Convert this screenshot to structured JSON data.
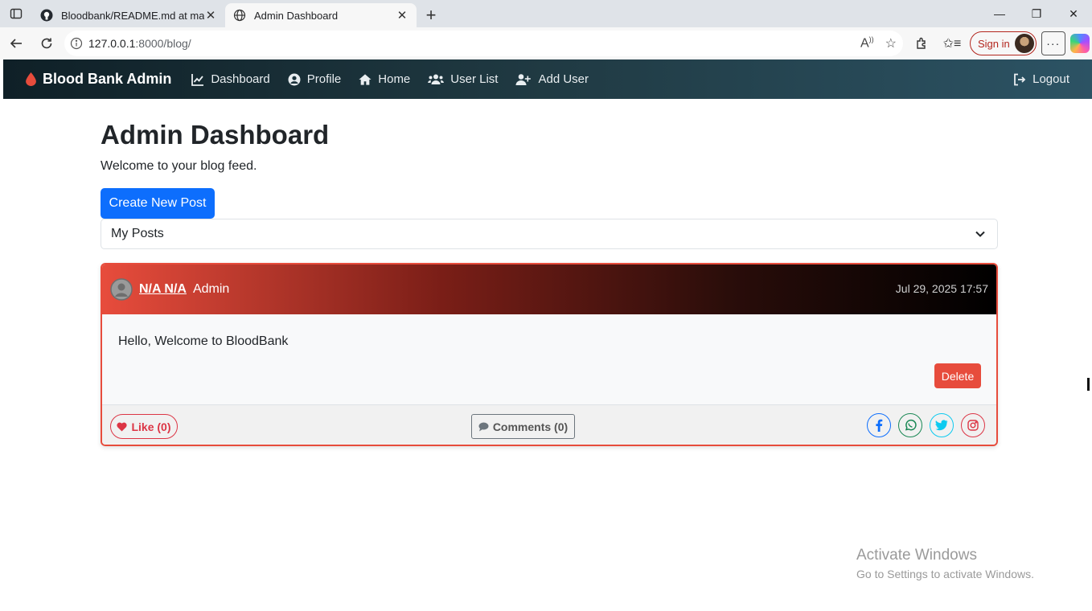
{
  "browser": {
    "tabs": [
      {
        "title": "Bloodbank/README.md at main ·",
        "favicon": "github-icon",
        "active": false
      },
      {
        "title": "Admin Dashboard",
        "favicon": "globe-icon",
        "active": true
      }
    ],
    "url_host": "127.0.0.1",
    "url_path": ":8000/blog/",
    "signin_label": "Sign in"
  },
  "nav": {
    "brand": "Blood Bank Admin",
    "links": [
      {
        "label": "Dashboard",
        "icon": "chart-line-icon"
      },
      {
        "label": "Profile",
        "icon": "user-circle-icon"
      },
      {
        "label": "Home",
        "icon": "home-icon"
      },
      {
        "label": "User List",
        "icon": "users-icon"
      },
      {
        "label": "Add User",
        "icon": "user-plus-icon"
      }
    ],
    "logout": "Logout"
  },
  "page": {
    "title": "Admin Dashboard",
    "lead": "Welcome to your blog feed.",
    "create_button": "Create New Post",
    "filter_selected": "My Posts"
  },
  "post": {
    "author": "N/A N/A",
    "role": "Admin",
    "date": "Jul 29, 2025 17:57",
    "body": "Hello, Welcome to BloodBank",
    "delete_label": "Delete",
    "like_label": "Like (0)",
    "comments_label": "Comments (0)",
    "share_icons": [
      "facebook-icon",
      "whatsapp-icon",
      "twitter-icon",
      "instagram-icon"
    ]
  },
  "watermark": {
    "line1": "Activate Windows",
    "line2": "Go to Settings to activate Windows."
  },
  "colors": {
    "primary": "#0d6efd",
    "danger": "#e74c3c",
    "nav_gradient_start": "#0f2027",
    "nav_gradient_end": "#2c5364"
  }
}
